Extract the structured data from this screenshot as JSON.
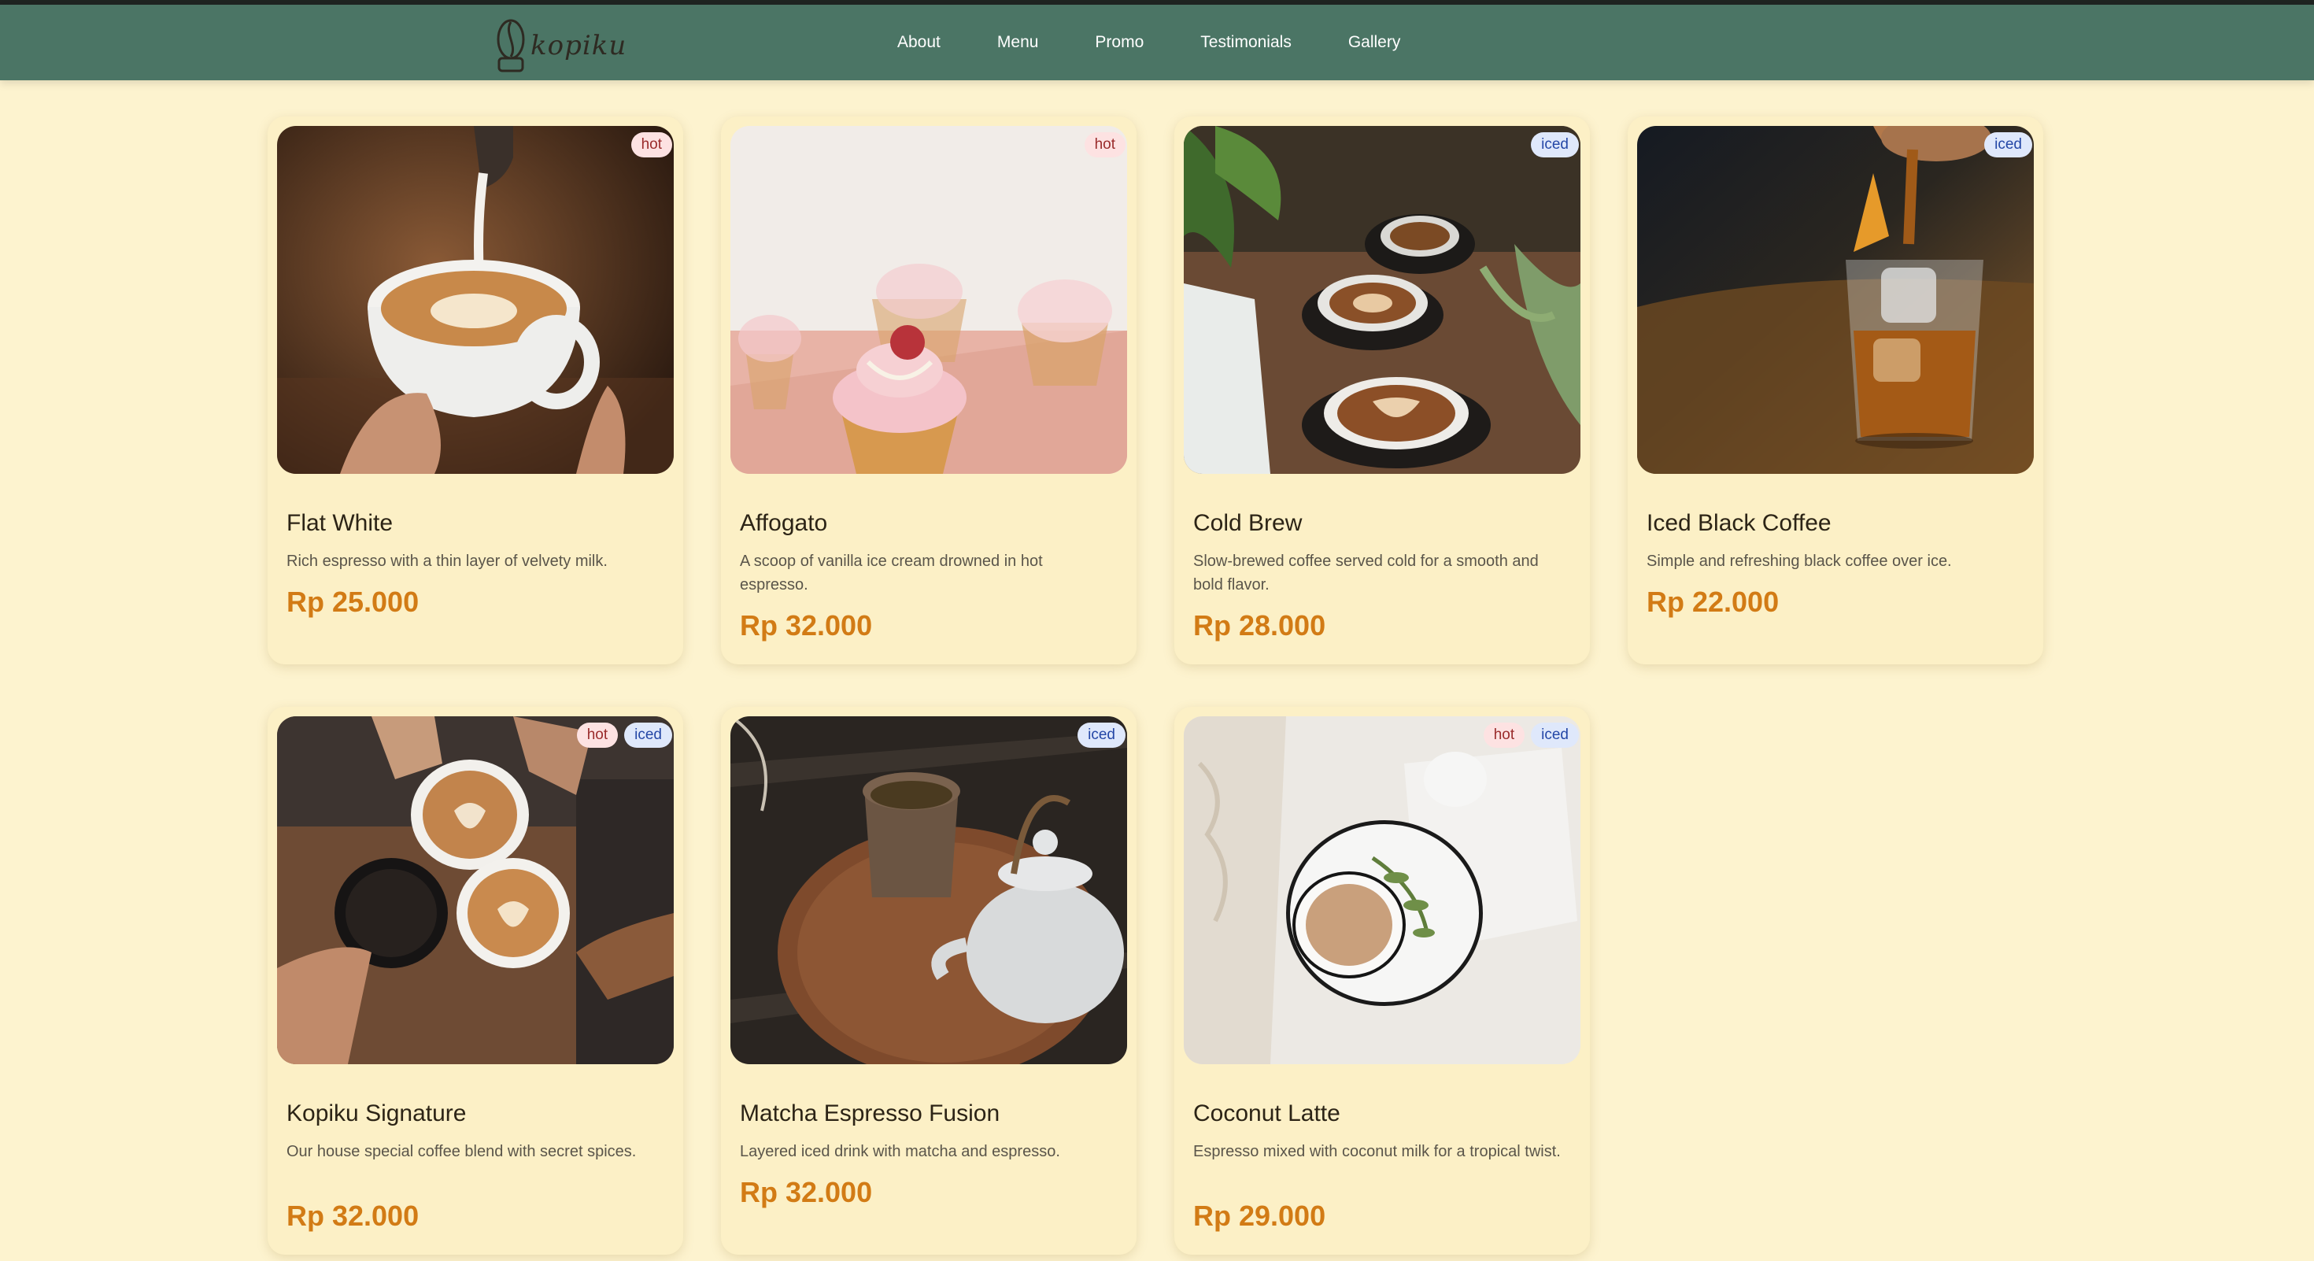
{
  "brand": {
    "name": "kopiku"
  },
  "nav": {
    "links": [
      "About",
      "Menu",
      "Promo",
      "Testimonials",
      "Gallery"
    ]
  },
  "colors": {
    "navbar": "#4b7565",
    "page_bg": "#fdf3cf",
    "price": "#d27b15",
    "tag_hot_bg": "#fde2e2",
    "tag_iced_bg": "#dfe8fb"
  },
  "products": [
    {
      "title": "Flat White",
      "desc": "Rich espresso with a thin layer of velvety milk.",
      "price": "Rp 25.000",
      "tags": [
        "hot"
      ],
      "image": "latte-pour-photo"
    },
    {
      "title": "Affogato",
      "desc": "A scoop of vanilla ice cream drowned in hot espresso.",
      "price": "Rp 32.000",
      "tags": [
        "hot"
      ],
      "image": "cupcakes-photo"
    },
    {
      "title": "Cold Brew",
      "desc": "Slow-brewed coffee served cold for a smooth and bold flavor.",
      "price": "Rp 28.000",
      "tags": [
        "iced"
      ],
      "image": "coffee-table-plants-photo"
    },
    {
      "title": "Iced Black Coffee",
      "desc": "Simple and refreshing black coffee over ice.",
      "price": "Rp 22.000",
      "tags": [
        "iced"
      ],
      "image": "iced-glass-pour-photo"
    },
    {
      "title": "Kopiku Signature",
      "desc": "Our house special coffee blend with secret spices.",
      "price": "Rp 32.000",
      "tags": [
        "hot",
        "iced"
      ],
      "image": "coffee-cheers-photo"
    },
    {
      "title": "Matcha Espresso Fusion",
      "desc": "Layered iced drink with matcha and espresso.",
      "price": "Rp 32.000",
      "tags": [
        "iced"
      ],
      "image": "teapot-tray-photo"
    },
    {
      "title": "Coconut Latte",
      "desc": "Espresso mixed with coconut milk for a tropical twist.",
      "price": "Rp 29.000",
      "tags": [
        "hot",
        "iced"
      ],
      "image": "latte-white-linen-photo"
    }
  ]
}
